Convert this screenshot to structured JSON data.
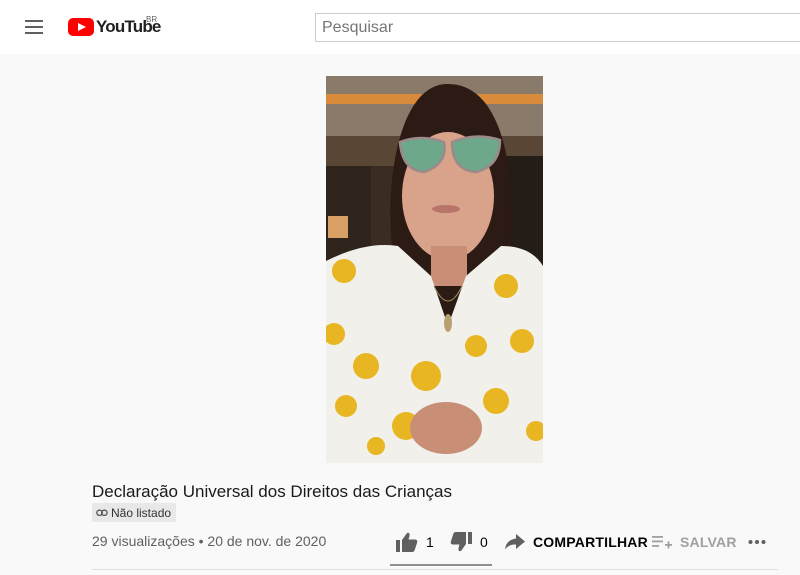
{
  "header": {
    "logo_text": "YouTube",
    "country_code": "BR",
    "search_placeholder": "Pesquisar"
  },
  "video": {
    "title": "Declaração Universal dos Direitos das Crianças",
    "visibility": "Não listado",
    "views_and_date": "29 visualizações • 20 de nov. de 2020"
  },
  "actions": {
    "like_count": "1",
    "dislike_count": "0",
    "share_label": "COMPARTILHAR",
    "save_label": "SALVAR",
    "like_ratio": 1.0
  },
  "colors": {
    "brand_red": "#ff0000",
    "background": "#f9f9f9",
    "text_secondary": "#606060"
  }
}
